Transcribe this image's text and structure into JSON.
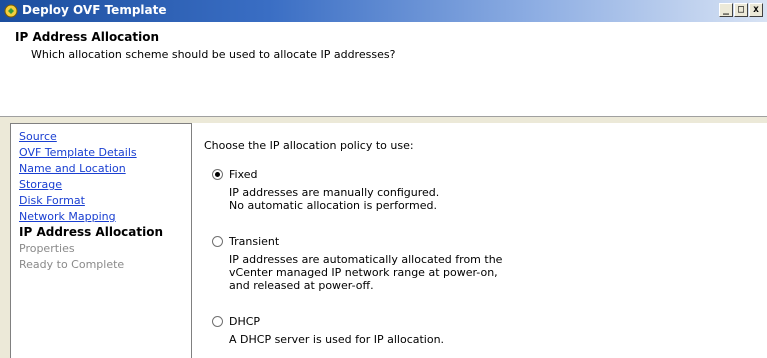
{
  "window": {
    "title": "Deploy OVF Template",
    "controls": {
      "minimize": "_",
      "maximize": "□",
      "close": "x"
    },
    "icon": "vsphere-app-icon"
  },
  "header": {
    "title": "IP Address Allocation",
    "subtitle": "Which allocation scheme should be used to allocate IP addresses?"
  },
  "nav": {
    "items": [
      {
        "label": "Source",
        "state": "link"
      },
      {
        "label": "OVF Template Details",
        "state": "link"
      },
      {
        "label": "Name and Location",
        "state": "link"
      },
      {
        "label": "Storage",
        "state": "link"
      },
      {
        "label": "Disk Format",
        "state": "link"
      },
      {
        "label": "Network Mapping",
        "state": "link"
      },
      {
        "label": "IP Address Allocation",
        "state": "current"
      },
      {
        "label": "Properties",
        "state": "disabled"
      },
      {
        "label": "Ready to Complete",
        "state": "disabled"
      }
    ]
  },
  "content": {
    "prompt": "Choose the IP allocation policy to use:",
    "options": [
      {
        "label": "Fixed",
        "checked": true,
        "desc": [
          "IP addresses are manually configured.",
          "No automatic allocation is performed."
        ]
      },
      {
        "label": "Transient",
        "checked": false,
        "desc": [
          "IP addresses are automatically allocated from the",
          "vCenter managed IP network range at power-on,",
          "and released at power-off."
        ]
      },
      {
        "label": "DHCP",
        "checked": false,
        "desc": [
          "A DHCP server is used for IP allocation."
        ]
      }
    ]
  }
}
